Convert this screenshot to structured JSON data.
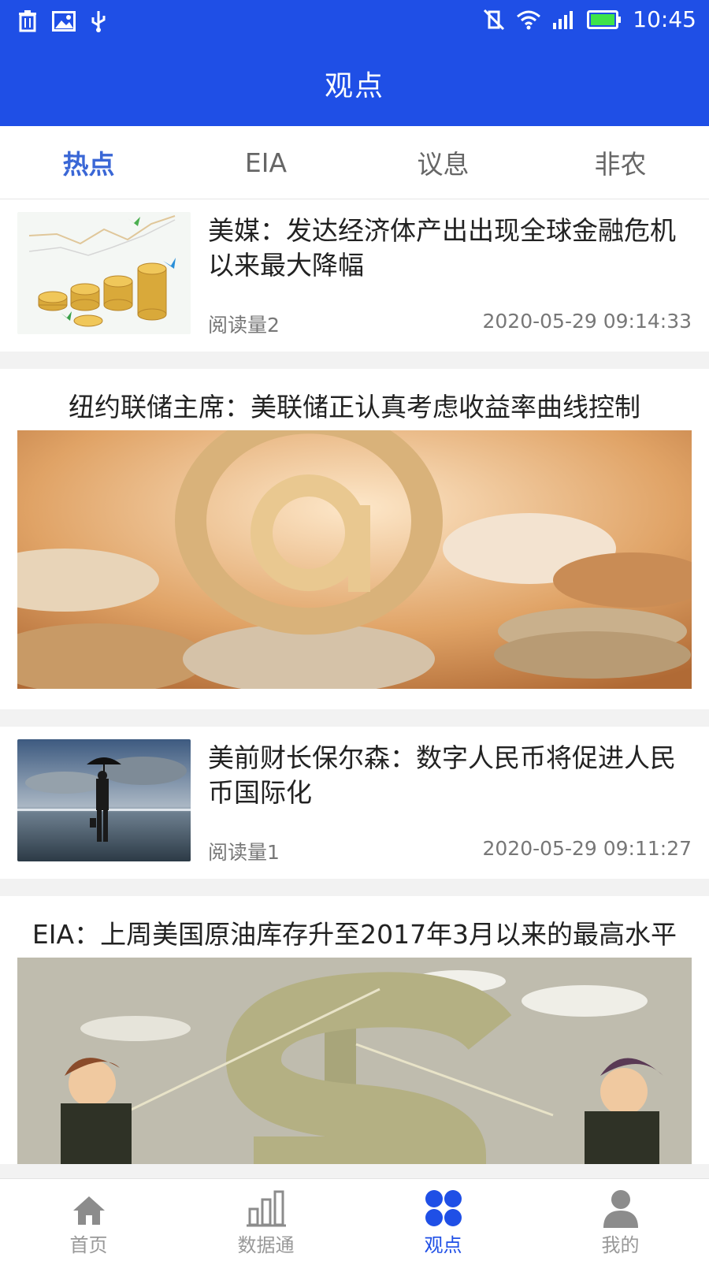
{
  "status_bar": {
    "time": "10:45"
  },
  "header": {
    "title": "观点"
  },
  "tabs": [
    {
      "label": "热点",
      "active": true
    },
    {
      "label": "EIA",
      "active": false
    },
    {
      "label": "议息",
      "active": false
    },
    {
      "label": "非农",
      "active": false
    }
  ],
  "articles": [
    {
      "title": "美媒：发达经济体产出出现全球金融危机以来最大降幅",
      "reads": "阅读量2",
      "time": "2020-05-29 09:14:33"
    },
    {
      "title": "纽约联储主席：美联储正认真考虑收益率曲线控制"
    },
    {
      "title": "美前财长保尔森：数字人民币将促进人民币国际化",
      "reads": "阅读量1",
      "time": "2020-05-29 09:11:27"
    },
    {
      "title": "EIA：上周美国原油库存升至2017年3月以来的最高水平"
    }
  ],
  "bottom_nav": [
    {
      "label": "首页",
      "icon": "home-icon"
    },
    {
      "label": "数据通",
      "icon": "bar-chart-icon"
    },
    {
      "label": "观点",
      "icon": "grid-icon",
      "active": true
    },
    {
      "label": "我的",
      "icon": "user-icon"
    }
  ],
  "colors": {
    "primary": "#1f4fe6",
    "active_tab": "#3a67d6"
  }
}
